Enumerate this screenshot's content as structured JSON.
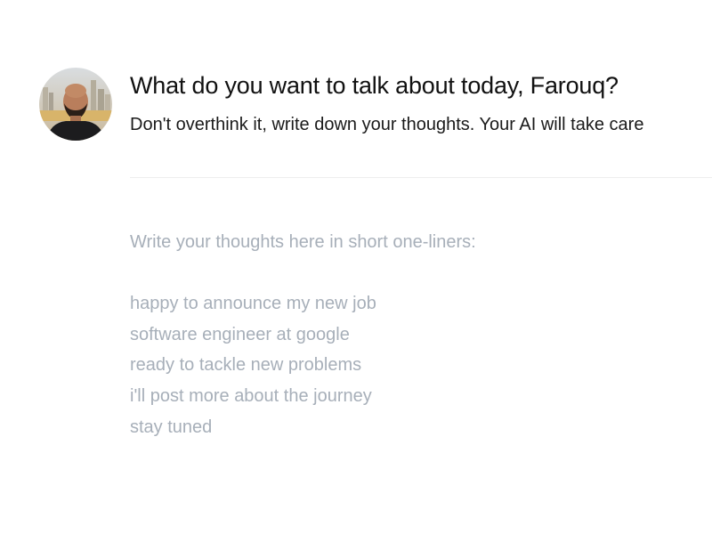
{
  "header": {
    "title": "What do you want to talk about today, Farouq?",
    "subtitle": "Don't overthink it, write down your thoughts. Your AI will take care"
  },
  "editor": {
    "placeholder": "Write your thoughts here in short one-liners:",
    "lines": [
      "happy to announce my new job",
      "software engineer at google",
      "ready to tackle new problems",
      "i'll post more about the journey",
      "stay tuned"
    ]
  },
  "colors": {
    "title": "#111111",
    "placeholder_text": "#a7afb9",
    "divider": "#eeeeee",
    "background": "#ffffff"
  },
  "icons": {
    "avatar": "user-profile-photo"
  }
}
